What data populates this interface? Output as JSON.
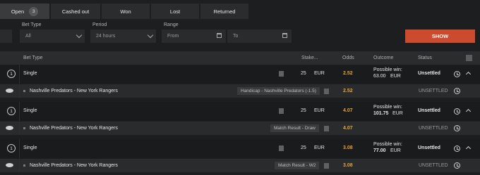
{
  "tabs": [
    {
      "label": "Open",
      "count": "3"
    },
    {
      "label": "Cashed out"
    },
    {
      "label": "Won"
    },
    {
      "label": "Lost"
    },
    {
      "label": "Returned"
    }
  ],
  "filters": {
    "bet_type_label": "Bet Type",
    "bet_type_value": "All",
    "period_label": "Period",
    "period_value": "24 hours",
    "range_label": "Range",
    "from_placeholder": "From",
    "to_placeholder": "To",
    "show_label": "SHOW"
  },
  "table_header": {
    "bet_type": "Bet Type",
    "stake": "Stake...",
    "odds": "Odds",
    "outcome": "Outcome",
    "status": "Status"
  },
  "bets": [
    {
      "index": "1",
      "type": "Single",
      "stake": "25",
      "currency": "EUR",
      "odds": "2.52",
      "win_label": "Possible win:",
      "win_amount": "63.00",
      "win_currency": "EUR",
      "status": "Unsettled",
      "selection": {
        "event": "Nashville Predators - New York Rangers",
        "market": "Handicap - Nashville Predators (-1.5)",
        "odds": "2.52",
        "status": "UNSETTLED"
      }
    },
    {
      "index": "1",
      "type": "Single",
      "stake": "25",
      "currency": "EUR",
      "odds": "4.07",
      "win_label": "Possible win:",
      "win_amount": "101.75",
      "win_currency": "EUR",
      "status": "Unsettled",
      "selection": {
        "event": "Nashville Predators - New York Rangers",
        "market": "Match Result - Draw",
        "odds": "4.07",
        "status": "UNSETTLED"
      }
    },
    {
      "index": "1",
      "type": "Single",
      "stake": "25",
      "currency": "EUR",
      "odds": "3.08",
      "win_label": "Possible win:",
      "win_amount": "77.00",
      "win_currency": "EUR",
      "status": "Unsettled",
      "selection": {
        "event": "Nashville Predators - New York Rangers",
        "market": "Match Result - W2",
        "odds": "3.08",
        "status": "UNSETTLED"
      }
    }
  ]
}
